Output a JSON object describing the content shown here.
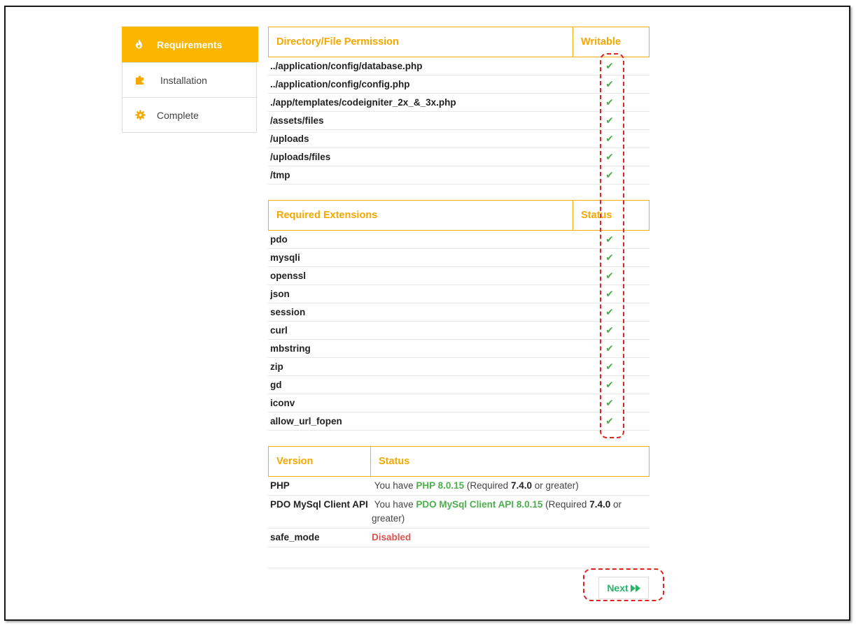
{
  "sidebar": {
    "items": [
      {
        "label": "Requirements",
        "icon": "fire-icon",
        "active": true
      },
      {
        "label": "Installation",
        "icon": "puzzle-icon",
        "active": false
      },
      {
        "label": "Complete",
        "icon": "gear-icon",
        "active": false
      }
    ]
  },
  "permissions": {
    "header_main": "Directory/File Permission",
    "header_side": "Writable",
    "rows": [
      "../application/config/database.php",
      "../application/config/config.php",
      "./app/templates/codeigniter_2x_&_3x.php",
      "/assets/files",
      "/uploads",
      "/uploads/files",
      "/tmp"
    ]
  },
  "extensions": {
    "header_main": "Required Extensions",
    "header_side": "Status",
    "rows": [
      "pdo",
      "mysqli",
      "openssl",
      "json",
      "session",
      "curl",
      "mbstring",
      "zip",
      "gd",
      "iconv",
      "allow_url_fopen"
    ]
  },
  "versions": {
    "header_main": "Version",
    "header_side": "Status",
    "php": {
      "name": "PHP",
      "prefix": "You have ",
      "value": "PHP 8.0.15",
      "mid": " (Required ",
      "required": "7.4.0",
      "suffix": " or greater)"
    },
    "pdo": {
      "name": "PDO MySql Client API",
      "prefix": "You have ",
      "value": "PDO MySql Client API 8.0.15",
      "mid": " (Required ",
      "required": "7.4.0",
      "suffix": " or greater)"
    },
    "safe_mode": {
      "name": "safe_mode",
      "value": "Disabled"
    }
  },
  "next_button": {
    "label": "Next"
  },
  "colors": {
    "accent": "#fbb700",
    "ok": "#4cae4c",
    "bad": "#d9534f",
    "next": "#2bb36b"
  }
}
